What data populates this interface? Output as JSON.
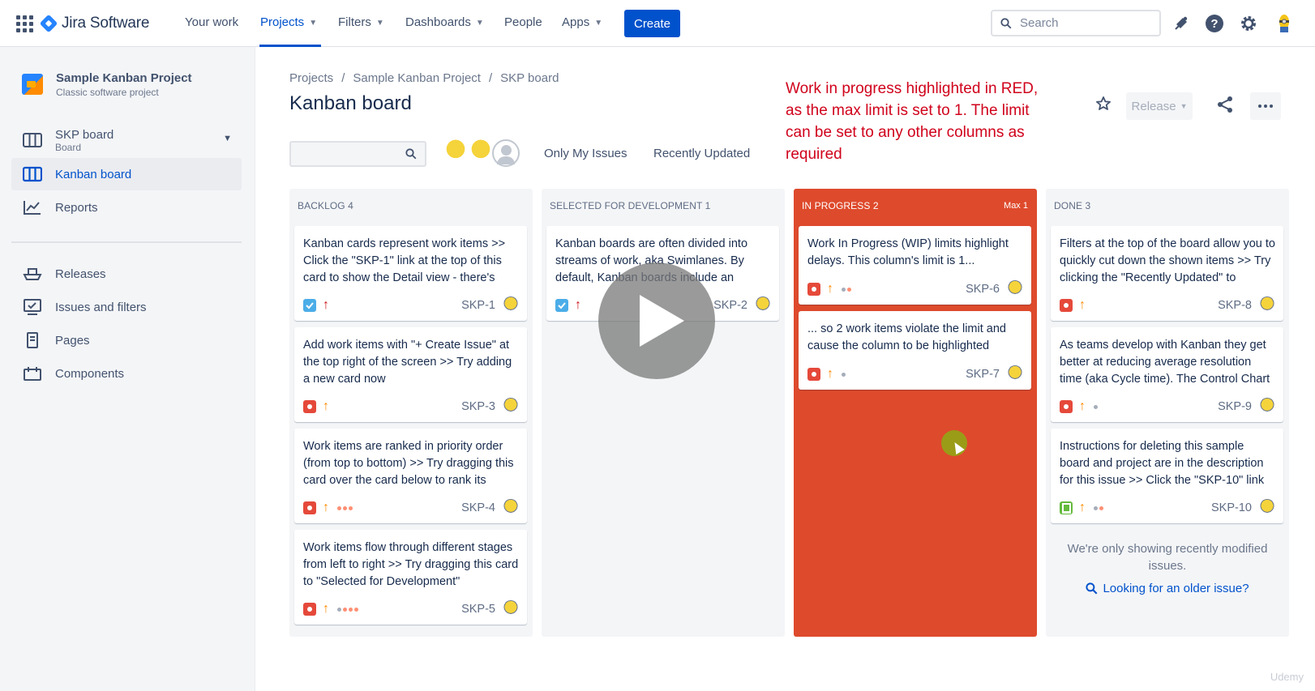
{
  "nav": {
    "product": "Jira Software",
    "items": {
      "your_work": "Your work",
      "projects": "Projects",
      "filters": "Filters",
      "dashboards": "Dashboards",
      "people": "People",
      "apps": "Apps"
    },
    "create": "Create",
    "search_placeholder": "Search"
  },
  "sidebar": {
    "project_name": "Sample Kanban Project",
    "project_type": "Classic software project",
    "board_name": "SKP board",
    "board_sub": "Board",
    "items": {
      "kanban": "Kanban board",
      "reports": "Reports",
      "releases": "Releases",
      "issues": "Issues and filters",
      "pages": "Pages",
      "components": "Components"
    }
  },
  "breadcrumb": [
    "Projects",
    "/",
    "Sample Kanban Project",
    "/",
    "SKP board"
  ],
  "page_title": "Kanban board",
  "annotation": "Work in progress highlighted in RED, as the max limit is set to 1. The limit can be set to any other columns as required",
  "actions": {
    "release": "Release"
  },
  "quick_filters": {
    "only_my": "Only My Issues",
    "recent": "Recently Updated"
  },
  "columns": [
    {
      "title": "BACKLOG 4",
      "cards": [
        {
          "summary": "Kanban cards represent work items >> Click the \"SKP-1\" link at the top of this card to show the Detail view - there's",
          "key": "SKP-1",
          "type": "task",
          "priority": "highest"
        },
        {
          "summary": "Add work items with \"+ Create Issue\" at the top right of the screen >> Try adding a new card now",
          "key": "SKP-3",
          "type": "bug",
          "priority": "medium"
        },
        {
          "summary": "Work items are ranked in priority order (from top to bottom) >> Try dragging this card over the card below to rank its",
          "key": "SKP-4",
          "type": "bug",
          "priority": "medium"
        },
        {
          "summary": "Work items flow through different stages from left to right >> Try dragging this card to \"Selected for Development\"",
          "key": "SKP-5",
          "type": "bug",
          "priority": "medium"
        }
      ]
    },
    {
      "title": "SELECTED FOR DEVELOPMENT 1",
      "cards": [
        {
          "summary": "Kanban boards are often divided into streams of work, aka Swimlanes. By default, Kanban boards include an",
          "key": "SKP-2",
          "type": "task",
          "priority": "highest"
        }
      ]
    },
    {
      "title": "IN PROGRESS 2",
      "max": "Max 1",
      "cards": [
        {
          "summary": "Work In Progress (WIP) limits highlight delays. This column's limit is 1...",
          "key": "SKP-6",
          "type": "bug",
          "priority": "medium"
        },
        {
          "summary": "... so 2 work items violate the limit and cause the column to be highlighted",
          "key": "SKP-7",
          "type": "bug",
          "priority": "medium"
        }
      ]
    },
    {
      "title": "DONE 3",
      "cards": [
        {
          "summary": "Filters at the top of the board allow you to quickly cut down the shown items >> Try clicking the \"Recently Updated\" to",
          "key": "SKP-8",
          "type": "bug",
          "priority": "medium"
        },
        {
          "summary": "As teams develop with Kanban they get better at reducing average resolution time (aka Cycle time). The Control Chart",
          "key": "SKP-9",
          "type": "bug",
          "priority": "medium"
        },
        {
          "summary": "Instructions for deleting this sample board and project are in the description for this issue >> Click the \"SKP-10\" link",
          "key": "SKP-10",
          "type": "story",
          "priority": "medium"
        }
      ],
      "note": "We're only showing recently modified issues.",
      "link": "Looking for an older issue?"
    }
  ],
  "watermark": "Udemy",
  "colors": {
    "accent": "#0052cc",
    "wip": "#de4a2c",
    "annotation": "#d0021b"
  }
}
